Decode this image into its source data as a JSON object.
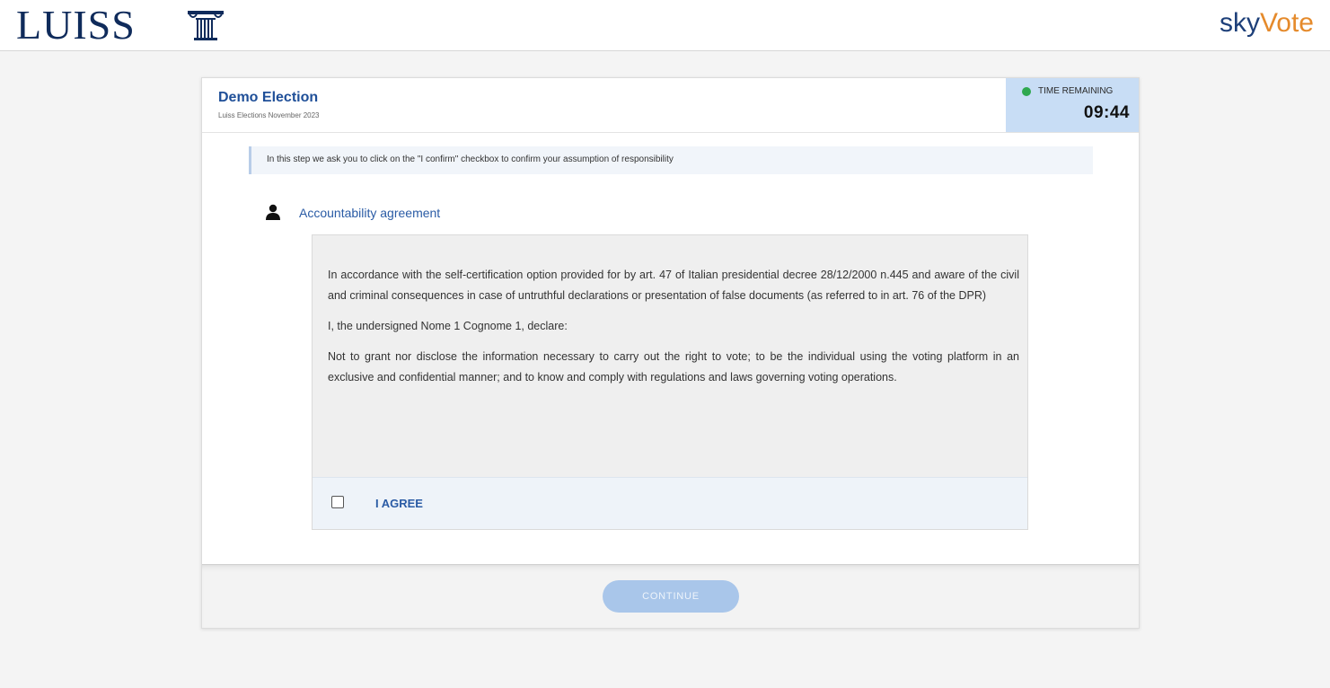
{
  "header": {
    "left_logo_text": "LUISS",
    "left_logo_icon": "column-icon",
    "right_logo_prefix": "sky",
    "right_logo_suffix": "Vote"
  },
  "card": {
    "title": "Demo Election",
    "subtitle": "Luiss Elections November 2023",
    "timer": {
      "label": "TIME REMAINING",
      "value": "09:44",
      "status_color": "#2fa84f"
    },
    "info_banner": "In this step we ask you to click on the \"I confirm\" checkbox to confirm your assumption of responsibility",
    "section": {
      "icon": "user-icon",
      "title": "Accountability agreement"
    },
    "agreement": {
      "paragraph_1": "In accordance with the self-certification option provided for by art. 47 of Italian presidential decree 28/12/2000 n.445 and aware of the civil and criminal consequences in case of untruthful declarations or presentation of false documents (as referred to in art. 76 of the DPR)",
      "paragraph_2": "I, the undersigned Nome 1 Cognome 1, declare:",
      "paragraph_3": "Not to grant nor disclose the information necessary to carry out the right to vote; to be the individual using the voting platform in an exclusive and confidential manner; and to know and comply with regulations and laws governing voting operations.",
      "checkbox_label": "I AGREE",
      "checked": false
    },
    "continue_label": "CONTINUE"
  },
  "colors": {
    "brand_navy": "#0f2b5b",
    "accent_blue": "#2a5ba5",
    "skyvote_orange": "#e58a2b",
    "timer_bg": "#c8ddf5",
    "button_disabled": "#a9c6ea"
  }
}
